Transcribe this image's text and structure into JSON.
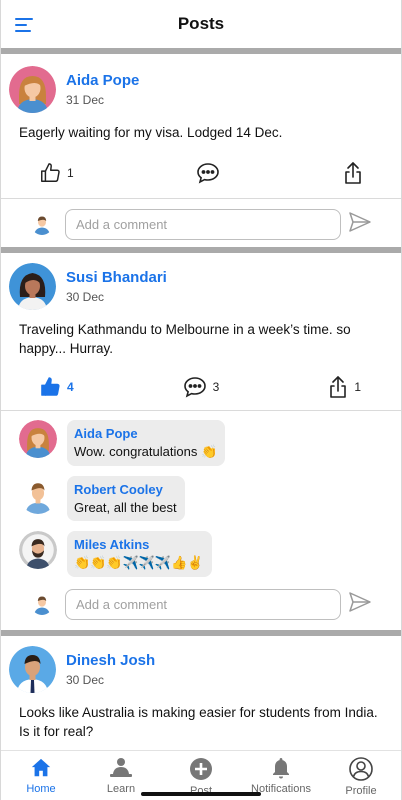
{
  "header": {
    "title": "Posts"
  },
  "colors": {
    "accent": "#1b73e8",
    "separator": "#aaaaaa",
    "bubble": "#ececec"
  },
  "posts": [
    {
      "author": "Aida Pope",
      "date": "31 Dec",
      "text": "Eagerly waiting for my visa. Lodged 14 Dec.",
      "likes": "1",
      "comments_count": "",
      "shares": "",
      "liked": false,
      "comment_placeholder": "Add a comment"
    },
    {
      "author": "Susi Bhandari",
      "date": "30 Dec",
      "text": "Traveling Kathmandu to Melbourne in a week’s time. so happy... Hurray.",
      "likes": "4",
      "comments_count": "3",
      "shares": "1",
      "liked": true,
      "comments": [
        {
          "name": "Aida Pope",
          "text": "Wow. congratulations 👏"
        },
        {
          "name": "Robert Cooley",
          "text": "Great, all the best"
        },
        {
          "name": "Miles Atkins",
          "text": "👏👏👏✈️✈️✈️👍✌️"
        }
      ],
      "comment_placeholder": "Add a comment"
    },
    {
      "author": "Dinesh Josh",
      "date": "30 Dec",
      "text": "Looks like Australia is making easier for students from India. Is it for real?"
    }
  ],
  "tabs": [
    {
      "label": "Home",
      "icon": "home-icon",
      "active": true
    },
    {
      "label": "Learn",
      "icon": "learn-icon",
      "active": false
    },
    {
      "label": "Post",
      "icon": "add-post-icon",
      "active": false
    },
    {
      "label": "Notifications",
      "icon": "bell-icon",
      "active": false
    },
    {
      "label": "Profile",
      "icon": "profile-icon",
      "active": false
    }
  ]
}
